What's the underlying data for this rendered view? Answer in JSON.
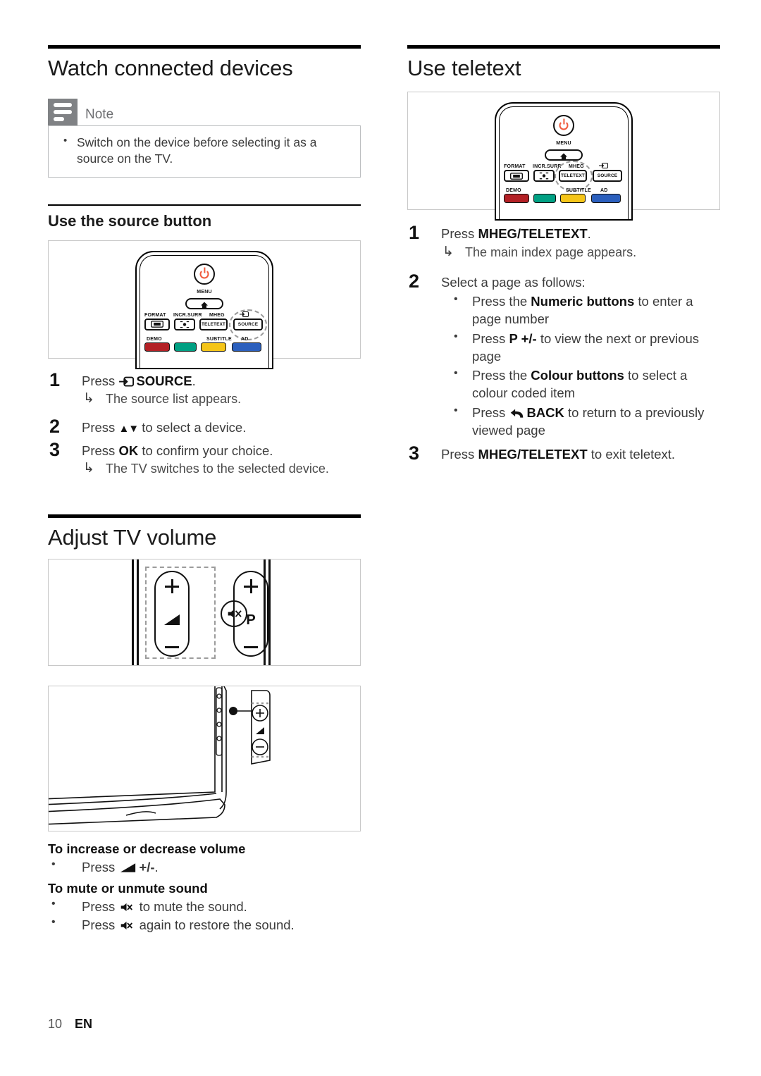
{
  "left_column": {
    "title": "Watch connected devices",
    "note": {
      "label": "Note",
      "bullets": [
        "Switch on the device before selecting it as a source on the TV."
      ]
    },
    "subsection": {
      "title": "Use the source button",
      "figure_name": "remote-control-source-button",
      "steps": [
        {
          "num": "1",
          "text_before": "Press ",
          "icon": "source-icon",
          "bold": "SOURCE",
          "text_after": ".",
          "result": "The source list appears."
        },
        {
          "num": "2",
          "text_before": "Press ",
          "arrows": "▲▼",
          "text_after": " to select a device.",
          "result": ""
        },
        {
          "num": "3",
          "text_before": "Press ",
          "bold": "OK",
          "text_after": " to confirm your choice.",
          "result": "The TV switches to the selected device."
        }
      ]
    },
    "volume_section": {
      "title": "Adjust TV volume",
      "figure_rocker_name": "remote-volume-rocker",
      "figure_tv_name": "tv-side-volume-buttons",
      "rocker_labels": {
        "plus": "+",
        "minus": "−",
        "programme": "P"
      },
      "groups": [
        {
          "heading": "To increase or decrease volume",
          "bullets": [
            {
              "text_before": "Press ",
              "icon": "volume-icon",
              "bold": "+/-",
              "text_after": "."
            }
          ]
        },
        {
          "heading": "To mute or unmute sound",
          "bullets": [
            {
              "text_before": "Press ",
              "icon": "mute-icon",
              "bold": "",
              "text_after": " to mute the sound."
            },
            {
              "text_before": "Press ",
              "icon": "mute-icon",
              "bold": "",
              "text_after": " again to restore the sound."
            }
          ]
        }
      ]
    }
  },
  "right_column": {
    "title": "Use teletext",
    "figure_name": "remote-control-teletext-button",
    "steps": [
      {
        "num": "1",
        "text_before": "Press ",
        "bold": "MHEG/TELETEXT",
        "text_after": ".",
        "result": "The main index page appears."
      },
      {
        "num": "2",
        "text_before": "Select a page as follows:",
        "bullets": [
          {
            "before": "Press the ",
            "bold": "Numeric buttons",
            "after": " to enter a page number"
          },
          {
            "before": "Press ",
            "bold": "P +/-",
            "after": " to view the next or previous page"
          },
          {
            "before": "Press the ",
            "bold": "Colour buttons",
            "after": " to select a colour coded item"
          },
          {
            "before": "Press ",
            "icon": "back-icon",
            "bold": "BACK",
            "after": " to return to a previously viewed page"
          }
        ]
      },
      {
        "num": "3",
        "text_before": "Press ",
        "bold": "MHEG/TELETEXT",
        "text_after": " to exit teletext."
      }
    ]
  },
  "remote": {
    "power_label": "power-button",
    "menu_label": "MENU",
    "keys": [
      {
        "label": "FORMAT",
        "key": "format"
      },
      {
        "label": "INCR.SURR",
        "key": "incr-surr"
      },
      {
        "label": "MHEG",
        "key": "TELETEXT"
      },
      {
        "label": "",
        "key": "SOURCE"
      }
    ],
    "colour_labels": {
      "red": "DEMO",
      "green": "",
      "yellow": "SUBTITLE",
      "blue": "AD"
    }
  },
  "footer": {
    "page": "10",
    "lang": "EN"
  },
  "colors": {
    "power": "#f05a3c",
    "red": "#b32025",
    "green": "#00a083",
    "yellow": "#f5c518",
    "blue": "#2b5fbd",
    "note_icon_bg": "#808285",
    "frame_border": "#c8c8c8",
    "rule": "#000000"
  }
}
